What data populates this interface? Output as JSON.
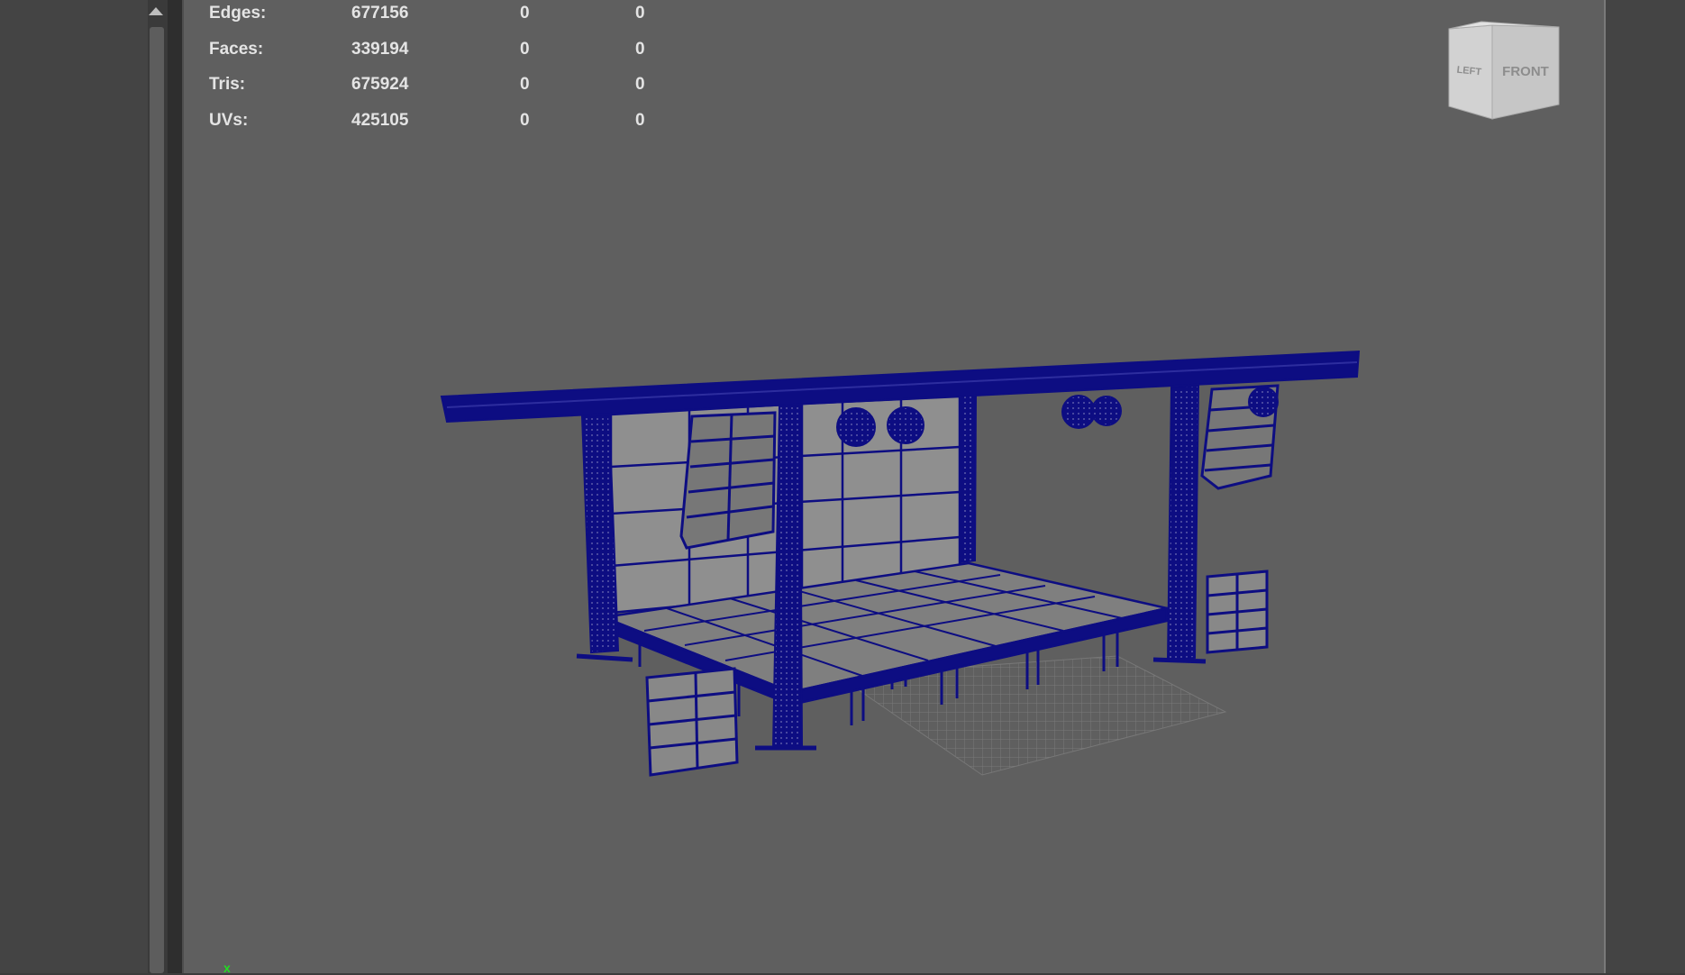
{
  "hud_stats": {
    "rows": [
      {
        "label": "Edges:",
        "v1": "677156",
        "v2": "0",
        "v3": "0"
      },
      {
        "label": "Faces:",
        "v1": "339194",
        "v2": "0",
        "v3": "0"
      },
      {
        "label": "Tris:",
        "v1": "675924",
        "v2": "0",
        "v3": "0"
      },
      {
        "label": "UVs:",
        "v1": "425105",
        "v2": "0",
        "v3": "0"
      }
    ]
  },
  "viewcube": {
    "left_label": "LEFT",
    "front_label": "FRONT"
  },
  "axis": {
    "label": "x"
  },
  "colors": {
    "wireframe": "#0d0d82",
    "viewport_bg": "#5f5f5f",
    "panel_bg": "#444444",
    "axis": "#22dd22"
  }
}
